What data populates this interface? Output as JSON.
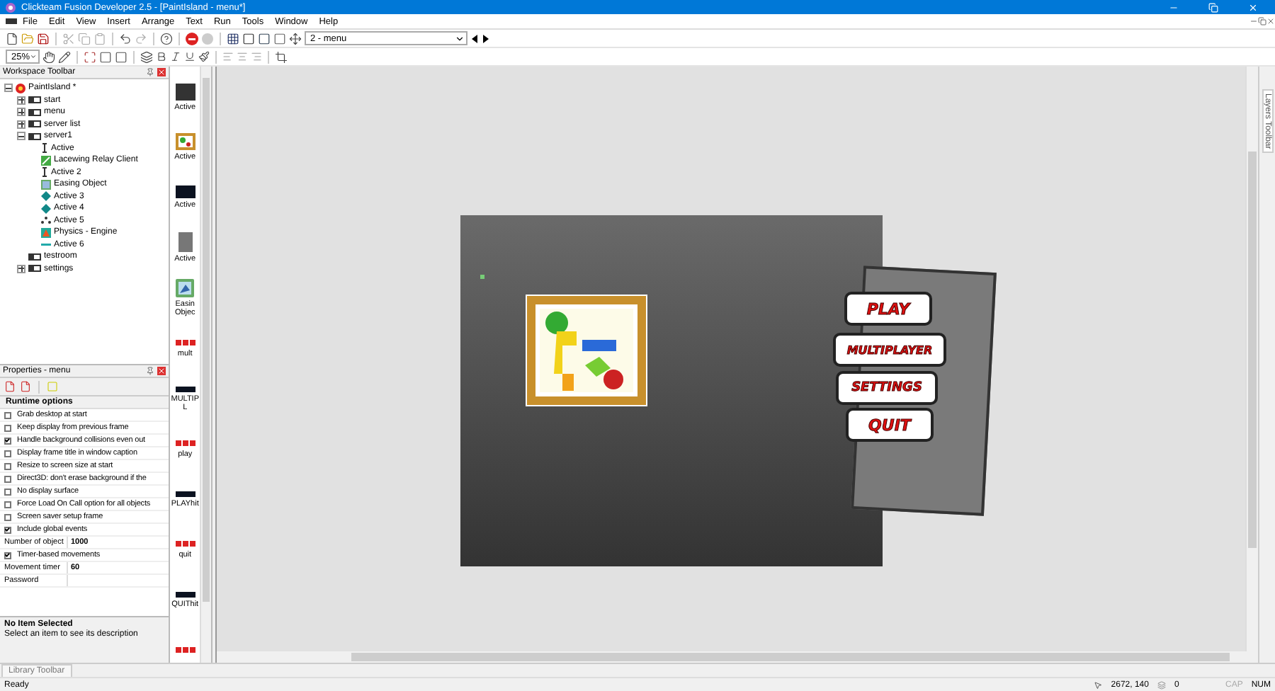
{
  "window": {
    "title": "Clickteam Fusion Developer 2.5 - [PaintIsland - menu*]"
  },
  "menu": [
    "File",
    "Edit",
    "View",
    "Insert",
    "Arrange",
    "Text",
    "Run",
    "Tools",
    "Window",
    "Help"
  ],
  "toolbar": {
    "frame_select": "2 - menu",
    "zoom": "25%"
  },
  "workspace": {
    "title": "Workspace Toolbar",
    "tree": [
      {
        "label": "PaintIsland *",
        "kind": "app",
        "expanded": true,
        "children": [
          {
            "label": "start",
            "kind": "frame",
            "expanded": false
          },
          {
            "label": "menu",
            "kind": "frame",
            "expanded": false
          },
          {
            "label": "server list",
            "kind": "frame",
            "expanded": false
          },
          {
            "label": "server1",
            "kind": "frame",
            "expanded": true,
            "children": [
              {
                "label": "Active",
                "kind": "cursor"
              },
              {
                "label": "Lacewing Relay Client",
                "kind": "network"
              },
              {
                "label": "Active 2",
                "kind": "cursor"
              },
              {
                "label": "Easing Object",
                "kind": "easing"
              },
              {
                "label": "Active 3",
                "kind": "diamond"
              },
              {
                "label": "Active 4",
                "kind": "diamond"
              },
              {
                "label": "Active 5",
                "kind": "dots"
              },
              {
                "label": "Physics - Engine",
                "kind": "physics"
              },
              {
                "label": "Active 6",
                "kind": "line"
              }
            ]
          },
          {
            "label": "testroom",
            "kind": "frame"
          },
          {
            "label": "settings",
            "kind": "frame",
            "expanded": false
          }
        ]
      }
    ]
  },
  "objects": [
    {
      "label": "Active",
      "kind": "dark"
    },
    {
      "label": "Active",
      "kind": "picture"
    },
    {
      "label": "Active",
      "kind": "navy"
    },
    {
      "label": "Active",
      "kind": "grey"
    },
    {
      "label": "Easin Objec",
      "kind": "easing"
    },
    {
      "label": "mult",
      "kind": "sprite"
    },
    {
      "label": "MULTIPL",
      "kind": "bar"
    },
    {
      "label": "play",
      "kind": "sprite"
    },
    {
      "label": "PLAYhit",
      "kind": "bar"
    },
    {
      "label": "quit",
      "kind": "sprite"
    },
    {
      "label": "QUIThit",
      "kind": "bar"
    },
    {
      "kind": "sprite"
    }
  ],
  "properties": {
    "title": "Properties - menu",
    "section": "Runtime options",
    "rows": [
      {
        "kind": "check",
        "label": "Grab desktop at start",
        "checked": false
      },
      {
        "kind": "check",
        "label": "Keep display from previous frame",
        "checked": false
      },
      {
        "kind": "check",
        "label": "Handle background collisions even out",
        "checked": true
      },
      {
        "kind": "check",
        "label": "Display frame title in window caption",
        "checked": false
      },
      {
        "kind": "check",
        "label": "Resize to screen size at start",
        "checked": false
      },
      {
        "kind": "check",
        "label": "Direct3D: don't erase background if the",
        "checked": false
      },
      {
        "kind": "check",
        "label": "No display surface",
        "checked": false
      },
      {
        "kind": "check",
        "label": "Force Load On Call option for all objects",
        "checked": false
      },
      {
        "kind": "check",
        "label": "Screen saver setup frame",
        "checked": false
      },
      {
        "kind": "check",
        "label": "Include global events",
        "checked": true
      },
      {
        "kind": "value",
        "label": "Number of object",
        "value": "1000"
      },
      {
        "kind": "check",
        "label": "Timer-based movements",
        "checked": true
      },
      {
        "kind": "value",
        "label": "Movement timer",
        "value": "60"
      },
      {
        "kind": "value",
        "label": "Password"
      }
    ],
    "description": {
      "title": "No Item Selected",
      "text": "Select an item to see its description"
    }
  },
  "scene": {
    "buttons": [
      "PLAY",
      "MULTIPLAYER",
      "SETTINGS",
      "QUIT"
    ]
  },
  "layers_tab": "Layers Toolbar",
  "library_tab": "Library Toolbar",
  "status_bar": {
    "text": "Ready",
    "coords": "2672, 140",
    "count": "0",
    "indicators": [
      {
        "label": "CAP",
        "on": false
      },
      {
        "label": "NUM",
        "on": true
      }
    ]
  }
}
